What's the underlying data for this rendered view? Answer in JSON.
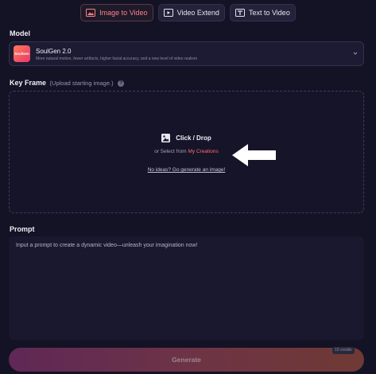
{
  "tabs": [
    {
      "label": "Image to Video",
      "icon": "image-to-video-icon",
      "active": true
    },
    {
      "label": "Video Extend",
      "icon": "video-extend-icon",
      "active": false
    },
    {
      "label": "Text to Video",
      "icon": "text-to-video-icon",
      "active": false
    }
  ],
  "model": {
    "section_label": "Model",
    "logo_text": "SoulGen",
    "name": "SoulGen 2.0",
    "description": "More natural motion, fewer artifacts, higher facial accuracy, and a new level of video realism"
  },
  "keyframe": {
    "label": "Key Frame",
    "hint": "(Upload starting image.)",
    "help": "?",
    "click_drop": "Click / Drop",
    "select_prefix": "or Select from",
    "select_link": "My Creations",
    "no_ideas": "No ideas? Go generate an image!"
  },
  "prompt": {
    "label": "Prompt",
    "placeholder": "Input a prompt to create a dynamic video—unleash your imagination now!"
  },
  "generate": {
    "label": "Generate",
    "credits": "10 credits"
  },
  "colors": {
    "background": "#141225",
    "accent": "#ff6d6d",
    "panel": "#1d1b33"
  }
}
